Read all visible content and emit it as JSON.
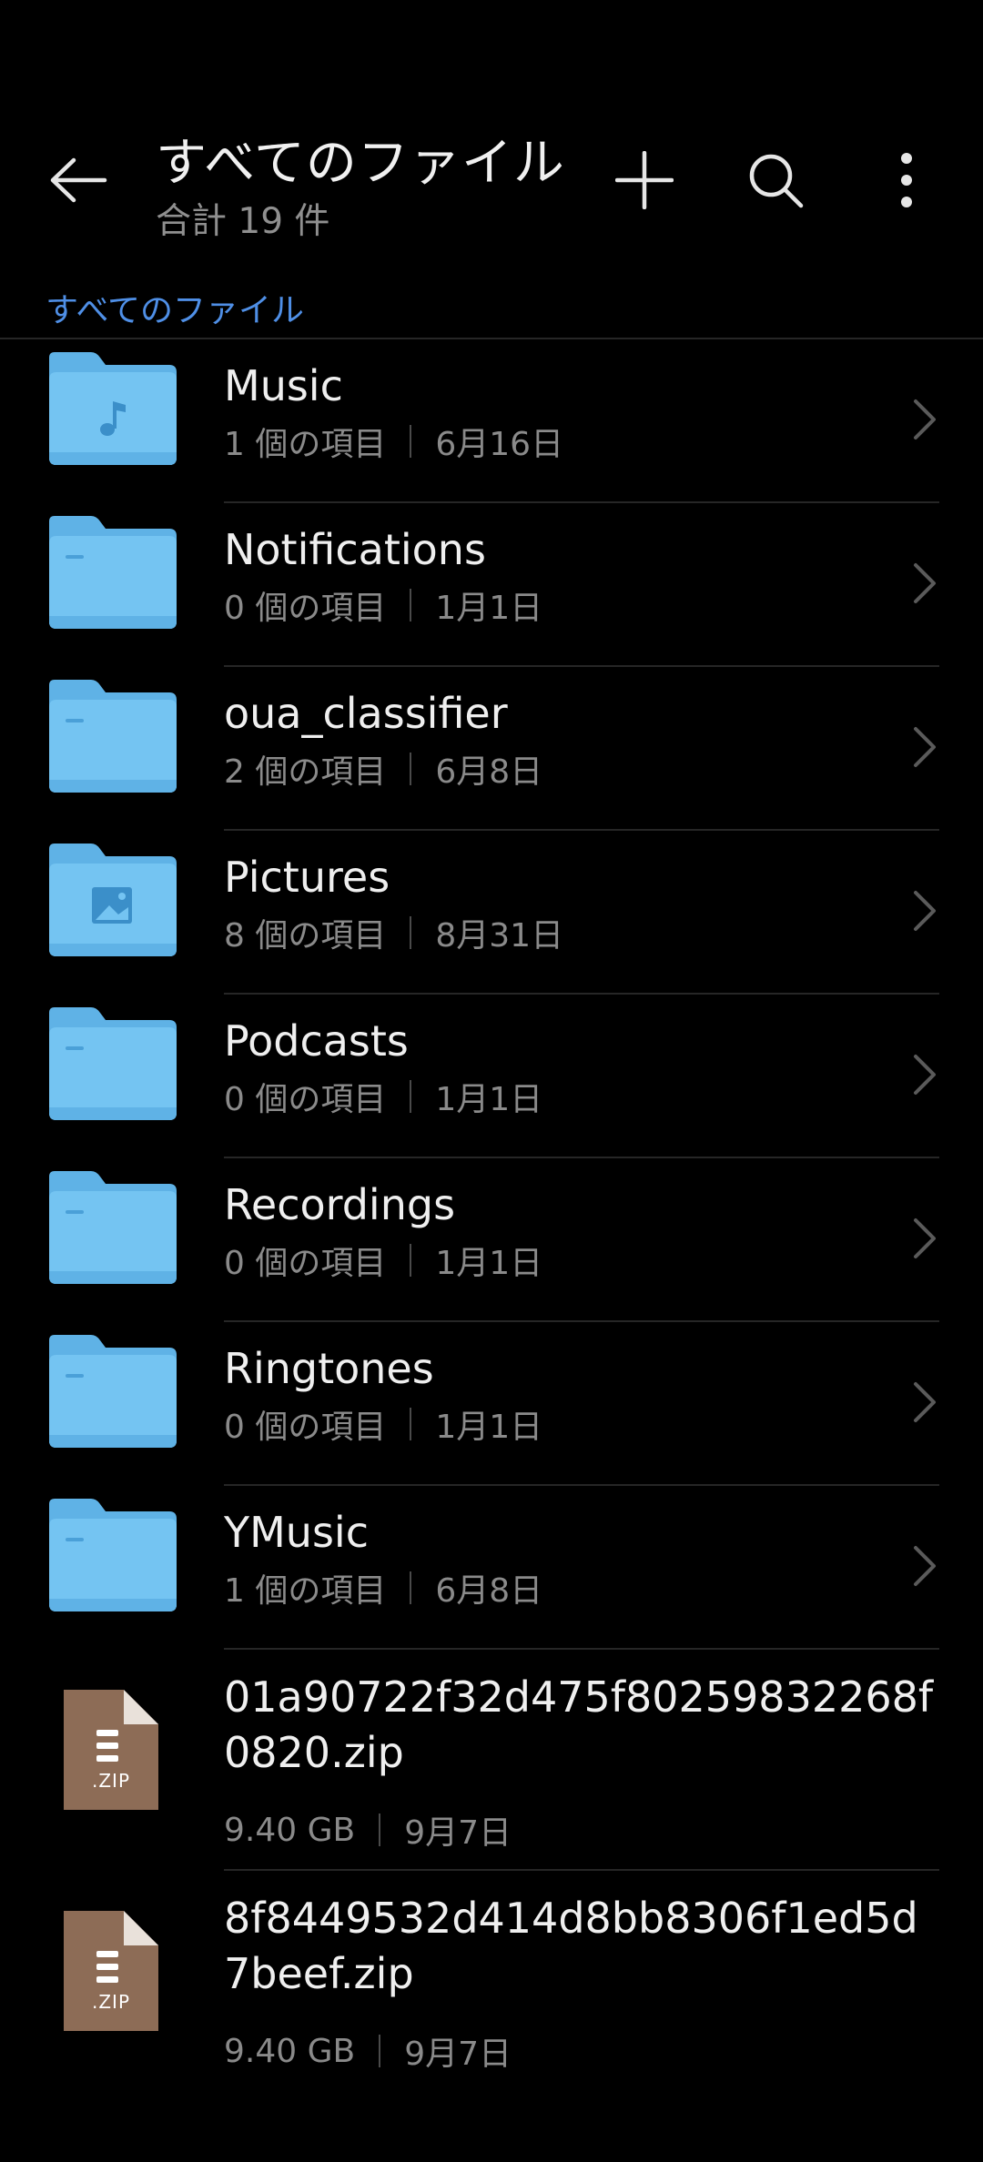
{
  "header": {
    "title": "すべてのファイル",
    "subtitle": "合計 19 件"
  },
  "breadcrumb": "すべてのファイル",
  "colors": {
    "background": "#000000",
    "folder": "#74c4f2",
    "accent": "#4f8fe6",
    "zip": "#8d6c56"
  },
  "items": [
    {
      "type": "folder",
      "icon": "music-folder-icon",
      "name": "Music",
      "count": "1 個の項目",
      "date": "6月16日"
    },
    {
      "type": "folder",
      "icon": "folder-icon",
      "name": "Notifications",
      "count": "0 個の項目",
      "date": "1月1日"
    },
    {
      "type": "folder",
      "icon": "folder-icon",
      "name": "oua_classifier",
      "count": "2 個の項目",
      "date": "6月8日"
    },
    {
      "type": "folder",
      "icon": "pictures-folder-icon",
      "name": "Pictures",
      "count": "8 個の項目",
      "date": "8月31日"
    },
    {
      "type": "folder",
      "icon": "folder-icon",
      "name": "Podcasts",
      "count": "0 個の項目",
      "date": "1月1日"
    },
    {
      "type": "folder",
      "icon": "folder-icon",
      "name": "Recordings",
      "count": "0 個の項目",
      "date": "1月1日"
    },
    {
      "type": "folder",
      "icon": "folder-icon",
      "name": "Ringtones",
      "count": "0 個の項目",
      "date": "1月1日"
    },
    {
      "type": "folder",
      "icon": "folder-icon",
      "name": "YMusic",
      "count": "1 個の項目",
      "date": "6月8日"
    },
    {
      "type": "file",
      "icon": "zip-file-icon",
      "icon_label": ".ZIP",
      "name": "01a90722f32d475f80259832268f0820.zip",
      "size": "9.40 GB",
      "date": "9月7日"
    },
    {
      "type": "file",
      "icon": "zip-file-icon",
      "icon_label": ".ZIP",
      "name": "8f8449532d414d8bb8306f1ed5d7beef.zip",
      "size": "9.40 GB",
      "date": "9月7日"
    }
  ]
}
